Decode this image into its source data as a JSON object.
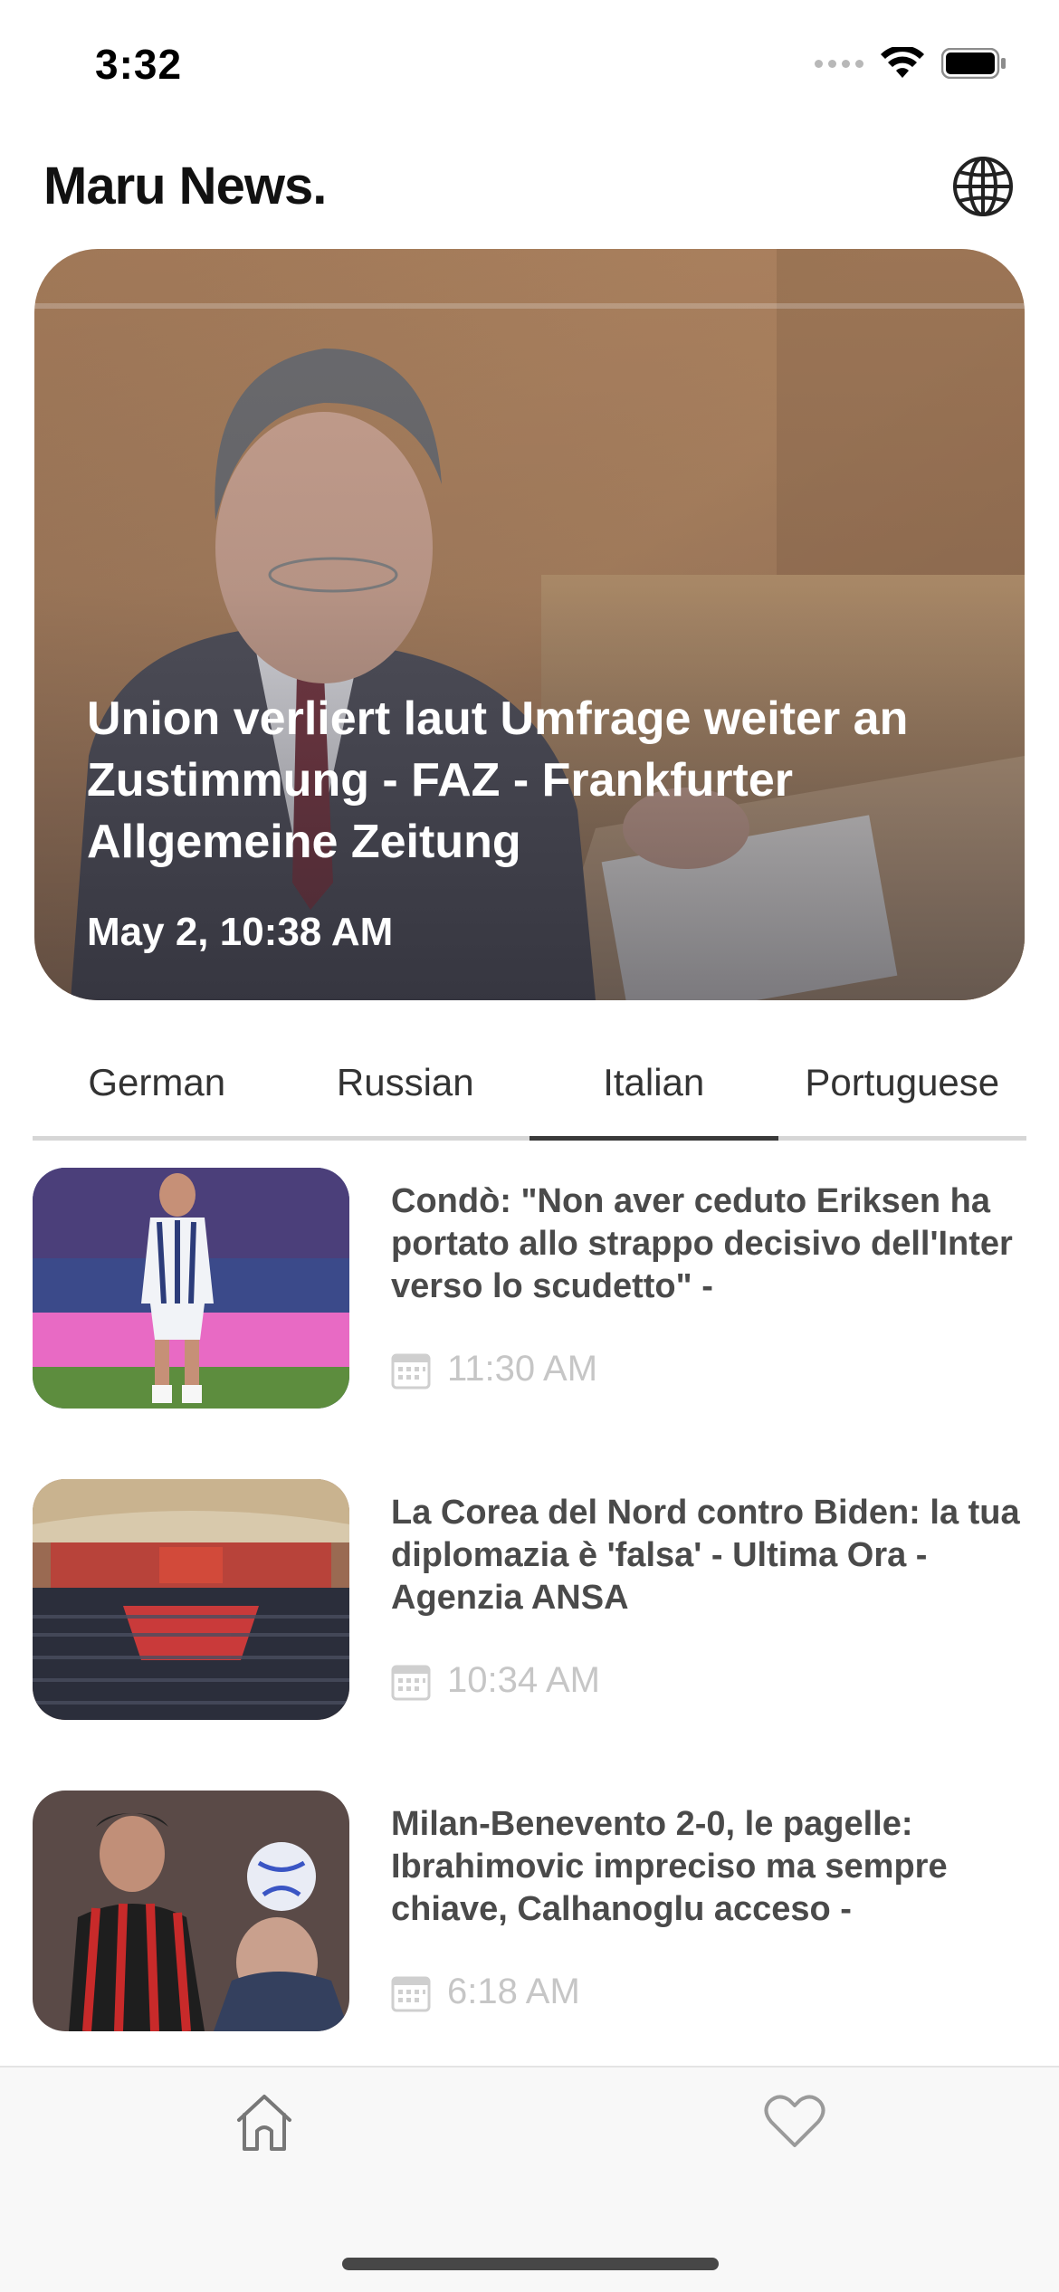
{
  "status_bar": {
    "time": "3:32"
  },
  "header": {
    "title": "Maru News.",
    "language_icon": "globe-icon"
  },
  "hero": {
    "headline": "Union verliert laut Umfrage weiter an Zustimmung - FAZ - Frankfurter Allgemeine Zeitung",
    "date": "May 2, 10:38 AM"
  },
  "tabs": [
    {
      "label": "German",
      "active": false
    },
    {
      "label": "Russian",
      "active": false
    },
    {
      "label": "Italian",
      "active": true
    },
    {
      "label": "Portuguese",
      "active": false
    }
  ],
  "articles": [
    {
      "title": "Condò: \"Non aver ceduto Eriksen ha portato allo strappo decisivo dell'Inter verso lo scudetto\" -",
      "time": "11:30 AM"
    },
    {
      "title": "La Corea del Nord contro Biden: la tua diplomazia è 'falsa' - Ultima Ora - Agenzia ANSA",
      "time": "10:34 AM"
    },
    {
      "title": "Milan-Benevento 2-0, le pagelle: Ibrahimovic impreciso ma sempre chiave, Calhanoglu acceso -",
      "time": "6:18 AM"
    }
  ],
  "tab_bar": {
    "items": [
      "home-icon",
      "heart-icon"
    ]
  },
  "colors": {
    "accent_underline": "#3a3a3a",
    "time_text": "#c6c6c6",
    "title_text": "#4a4a4a"
  }
}
